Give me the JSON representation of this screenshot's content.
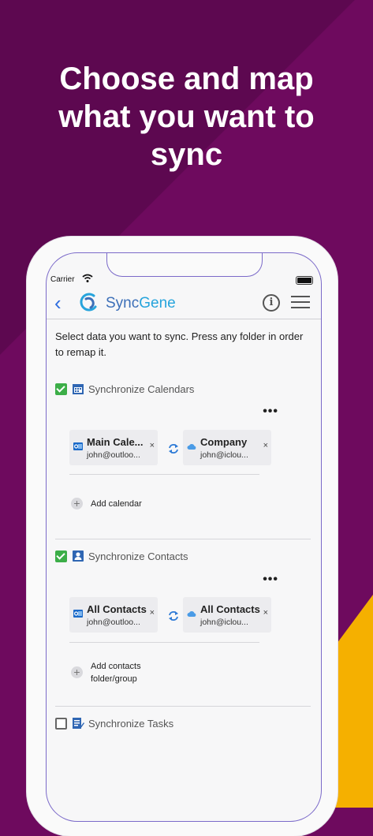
{
  "headline": [
    "Choose and map",
    "what you want to",
    "sync"
  ],
  "status_bar": {
    "carrier": "Carrier"
  },
  "navbar": {
    "brand_sync": "Sync",
    "brand_gene": "Gene",
    "info_label": "i"
  },
  "intro": "Select data you want to sync. Press any folder in order to remap it.",
  "sections": {
    "calendars": {
      "label": "Synchronize Calendars",
      "checked": true,
      "left": {
        "title": "Main Cale...",
        "account": "john@outloo..."
      },
      "right": {
        "title": "Company",
        "account": "john@iclou..."
      },
      "add_label": "Add calendar"
    },
    "contacts": {
      "label": "Synchronize Contacts",
      "checked": true,
      "left": {
        "title": "All Contacts",
        "account": "john@outloo..."
      },
      "right": {
        "title": "All Contacts",
        "account": "john@iclou..."
      },
      "add_label_1": "Add contacts",
      "add_label_2": "folder/group"
    },
    "tasks": {
      "label": "Synchronize Tasks",
      "checked": false
    }
  },
  "common": {
    "more": "•••",
    "remove": "×",
    "plus": "+"
  },
  "colors": {
    "background": "#6e0a5e",
    "accent_yellow": "#f5b000",
    "check_green": "#3cae48",
    "link_blue": "#2d6cdf"
  }
}
